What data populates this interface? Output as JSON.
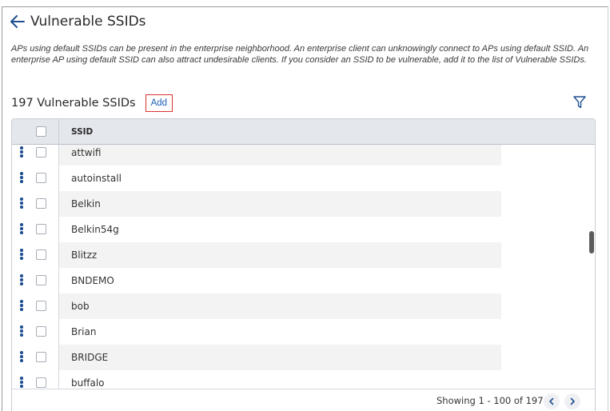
{
  "header": {
    "title": "Vulnerable SSIDs"
  },
  "description": "APs using default SSIDs can be present in the enterprise neighborhood. An enterprise client can unknowingly connect to APs using default SSID. An enterprise AP using default SSID can also attract undesirable clients. If you consider an SSID to be vulnerable, add it to the list of Vulnerable SSIDs.",
  "summary": {
    "count_title": "197 Vulnerable SSIDs",
    "add_label": "Add"
  },
  "table": {
    "columns": [
      "SSID"
    ],
    "rows": [
      {
        "ssid": "attwifi"
      },
      {
        "ssid": "autoinstall"
      },
      {
        "ssid": "Belkin"
      },
      {
        "ssid": "Belkin54g"
      },
      {
        "ssid": "Blitzz"
      },
      {
        "ssid": "BNDEMO"
      },
      {
        "ssid": "bob"
      },
      {
        "ssid": "Brian"
      },
      {
        "ssid": "BRIDGE"
      },
      {
        "ssid": "buffalo"
      }
    ]
  },
  "pagination": {
    "text": "Showing 1 - 100 of 197"
  },
  "colors": {
    "accent": "#1d4f91",
    "add_border": "#d9322f",
    "link": "#1a5fb4",
    "header_bg": "#e4e7ec",
    "stripe": "#f3f3f3"
  },
  "icons": {
    "back": "arrow-left-icon",
    "filter": "filter-icon",
    "row_menu": "kebab-menu-icon",
    "prev": "chevron-left-icon",
    "next": "chevron-right-icon"
  }
}
